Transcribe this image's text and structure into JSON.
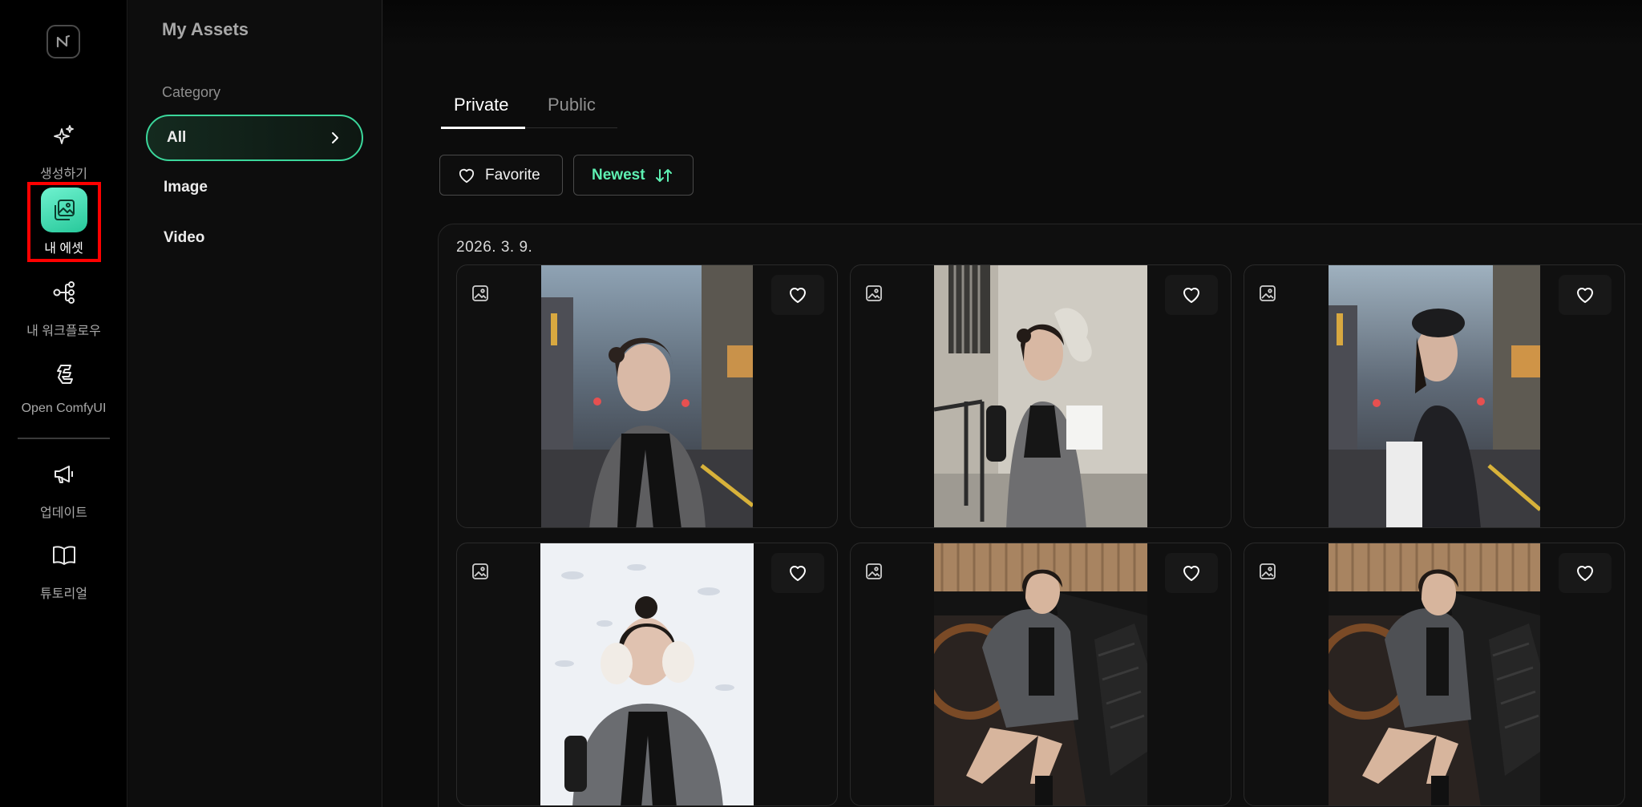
{
  "rail": {
    "items": [
      {
        "label": "생성하기",
        "icon": "sparkles-icon"
      },
      {
        "label": "내 에셋",
        "icon": "image-stack-icon",
        "active": true
      },
      {
        "label": "내 워크플로우",
        "icon": "workflow-icon"
      },
      {
        "label": "Open ComfyUI",
        "icon": "comfyui-icon"
      },
      {
        "label": "업데이트",
        "icon": "megaphone-icon"
      },
      {
        "label": "튜토리얼",
        "icon": "book-icon"
      }
    ]
  },
  "sidebar": {
    "title": "My Assets",
    "section": "Category",
    "categories": [
      {
        "label": "All",
        "active": true
      },
      {
        "label": "Image"
      },
      {
        "label": "Video"
      }
    ]
  },
  "main": {
    "tabs": [
      {
        "label": "Private",
        "active": true
      },
      {
        "label": "Public"
      }
    ],
    "favorite_label": "Favorite",
    "sort_label": "Newest",
    "group_date": "2026. 3. 9.",
    "assets": [
      {
        "type": "image",
        "scene": "street-scarf"
      },
      {
        "type": "image",
        "scene": "wall-shopping"
      },
      {
        "type": "image",
        "scene": "street-beret"
      },
      {
        "type": "image",
        "scene": "snow-gloves"
      },
      {
        "type": "image",
        "scene": "car-seat"
      },
      {
        "type": "image",
        "scene": "car-seat-2"
      }
    ]
  },
  "colors": {
    "accent": "#3bd79b",
    "accent_text": "#5ef0b2",
    "highlight_frame": "#ff0000"
  }
}
